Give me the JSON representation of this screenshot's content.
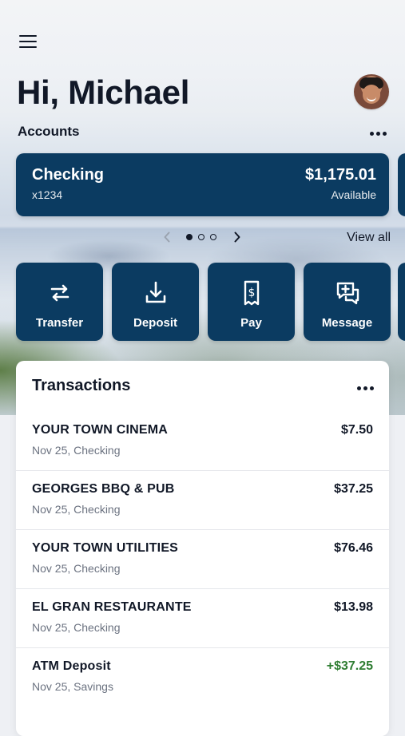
{
  "header": {
    "greeting": "Hi, Michael"
  },
  "accounts": {
    "title": "Accounts",
    "card": {
      "name": "Checking",
      "mask": "x1234",
      "balance": "$1,175.01",
      "balance_label": "Available"
    },
    "pager": {
      "pages": 3,
      "active_page": 1
    },
    "view_all": "View all"
  },
  "actions": [
    {
      "label": "Transfer",
      "icon": "transfer-icon"
    },
    {
      "label": "Deposit",
      "icon": "deposit-icon"
    },
    {
      "label": "Pay",
      "icon": "pay-icon"
    },
    {
      "label": "Message",
      "icon": "message-icon"
    }
  ],
  "transactions": {
    "title": "Transactions",
    "items": [
      {
        "merchant": "YOUR TOWN CINEMA",
        "meta": "Nov 25, Checking",
        "amount": "$7.50",
        "positive": false
      },
      {
        "merchant": "GEORGES BBQ & PUB",
        "meta": "Nov 25, Checking",
        "amount": "$37.25",
        "positive": false
      },
      {
        "merchant": "YOUR TOWN UTILITIES",
        "meta": "Nov 25, Checking",
        "amount": "$76.46",
        "positive": false
      },
      {
        "merchant": "EL GRAN RESTAURANTE",
        "meta": "Nov 25, Checking",
        "amount": "$13.98",
        "positive": false
      },
      {
        "merchant": "ATM Deposit",
        "meta": "Nov 25, Savings",
        "amount": "+$37.25",
        "positive": true
      }
    ]
  },
  "colors": {
    "primary": "#0b3b61",
    "positive": "#2f7d32",
    "muted": "#6b7280"
  }
}
